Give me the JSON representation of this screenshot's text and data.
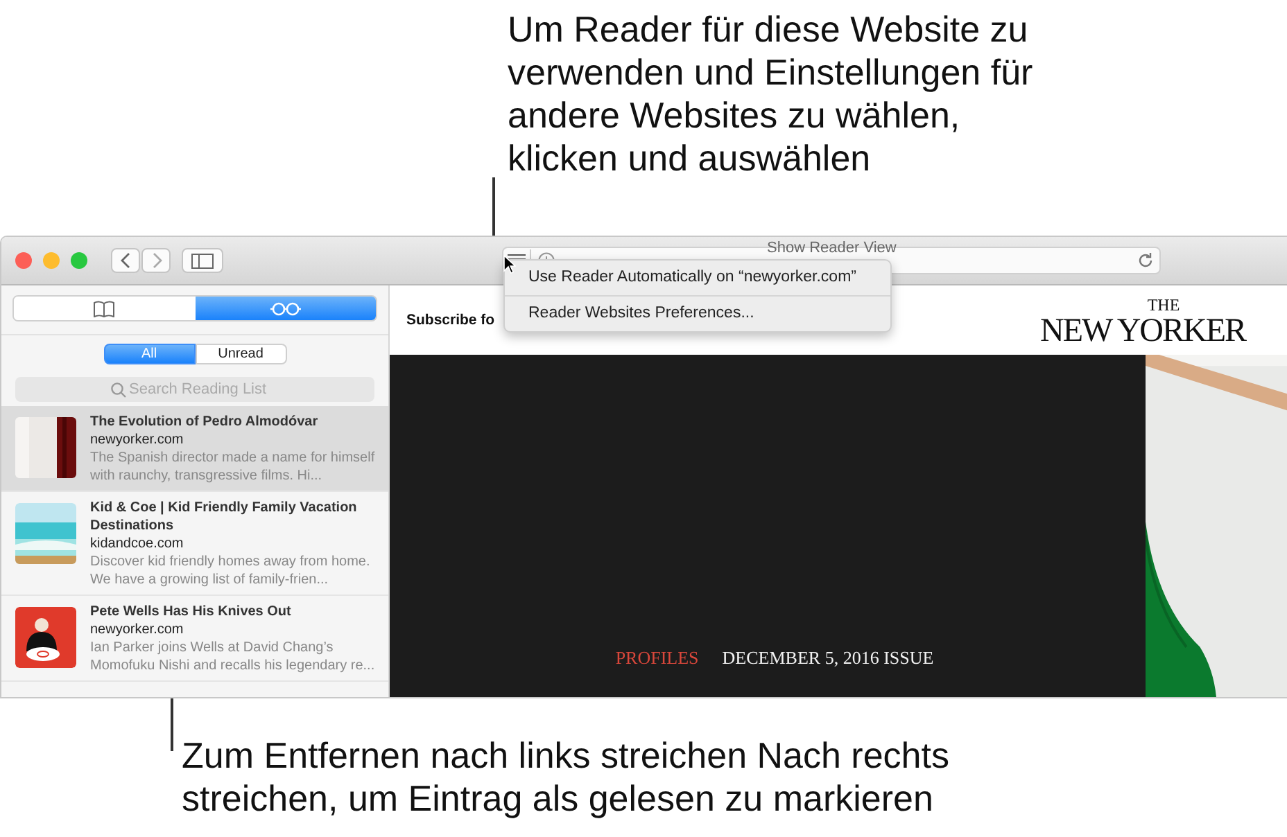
{
  "callouts": [
    {
      "text": "Um Reader für diese Website zu\nverwenden und Einstellungen für\nandere Websites zu wählen,\nklicken und auswählen"
    },
    {
      "text": "Zum Entfernen nach links streichen Nach rechts\nstreichen, um Eintrag als gelesen zu markieren"
    }
  ],
  "toolbar": {
    "address": "Show Reader View"
  },
  "reader_menu": {
    "items": [
      {
        "label": "Use Reader Automatically on “newyorker.com”"
      },
      {
        "label": "Reader Websites Preferences..."
      }
    ]
  },
  "sidebar": {
    "tabs": [
      {
        "kind": "bookmarks",
        "selected": false
      },
      {
        "kind": "reading-list",
        "selected": true
      }
    ],
    "filters": [
      {
        "label": "All",
        "selected": true
      },
      {
        "label": "Unread",
        "selected": false
      }
    ],
    "search": {
      "placeholder": "Search Reading List"
    },
    "items": [
      {
        "title": "The Evolution of Pedro Almodóvar",
        "domain": "newyorker.com",
        "excerpt": "The Spanish director made a name for himself with raunchy, transgressive films. Hi...",
        "selected": true,
        "kind": "curtain"
      },
      {
        "title": "Kid & Coe | Kid Friendly Family Vacation Destinations",
        "domain": "kidandcoe.com",
        "excerpt": "Discover kid friendly homes away from home. We have a growing list of family-frien...",
        "selected": false,
        "kind": "beach"
      },
      {
        "title": "Pete Wells Has His Knives Out",
        "domain": "newyorker.com",
        "excerpt": "Ian Parker joins Wells at David Chang’s Momofuku Nishi and recalls his legendary re...",
        "selected": false,
        "kind": "figure"
      }
    ]
  },
  "page": {
    "subscribe": "Subscribe fo",
    "logo_top": "THE",
    "logo": "NEW YORKER",
    "section": "PROFILES",
    "issue": "DECEMBER 5, 2016 ISSUE"
  }
}
